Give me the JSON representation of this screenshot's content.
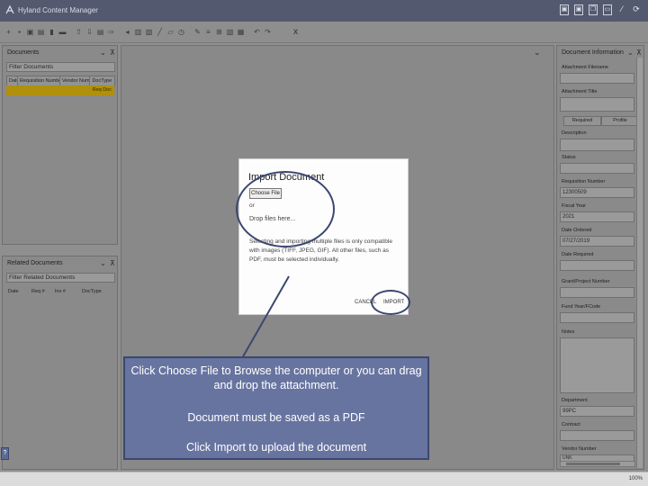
{
  "app": {
    "title": "Hyland Content Manager",
    "window_buttons": [
      "▣",
      "▣",
      "❐",
      "▭",
      "⁄",
      "⟳"
    ]
  },
  "toolbar": {
    "icons": [
      "plus-icon",
      "save-icon",
      "lock-icon",
      "copy-icon",
      "delete-icon",
      "print-icon",
      "separator",
      "upload-icon",
      "download-icon",
      "link-icon",
      "unlink-icon",
      "separator",
      "move-icon",
      "grid-icon",
      "stamp-icon",
      "pen-icon",
      "eraser-icon",
      "clock-icon",
      "separator",
      "markup-icon",
      "align-icon",
      "text-icon",
      "image-icon",
      "table-icon",
      "separator",
      "rotate-left-icon",
      "rotate-right-icon"
    ],
    "glyphs": [
      "+",
      "▪",
      "▣",
      "▤",
      "▮",
      "▬",
      "",
      "⇧",
      "⇩",
      "▤",
      "⇨",
      "",
      "◂",
      "▥",
      "▧",
      "╱",
      "▱",
      "◷",
      "",
      "✎",
      "≡",
      "⊞",
      "▧",
      "▦",
      "",
      "↶",
      "↷"
    ],
    "close": "x"
  },
  "documents_panel": {
    "title": "Documents",
    "filter_placeholder": "Filter Documents",
    "columns": [
      "Date",
      "Requisition Number",
      "Vendor Number",
      "DocType"
    ],
    "selected_row_text": "Req Doc"
  },
  "related_panel": {
    "title": "Related Documents",
    "filter_placeholder": "Filter Related Documents",
    "columns": [
      "Date",
      "Req #",
      "Inv #",
      "DocType"
    ]
  },
  "modal": {
    "title": "Import Document",
    "choose_file": "Choose File",
    "or": "or",
    "drop": "Drop files here...",
    "compat": "Selecting and importing multiple files is only compatible with images (TIFF, JPEG, GIF). All other files, such as PDF, must be selected individually.",
    "cancel": "CANCEL",
    "import": "IMPORT"
  },
  "callout": {
    "line1": "Click Choose File to Browse the computer or you can drag and drop the attachment.",
    "line2": "Document must be saved as a PDF",
    "line3": "Click Import to upload the document"
  },
  "info_panel": {
    "title": "Document Information",
    "attachment_filename": "Attachment Filename",
    "attachment_title": "Attachment Title",
    "tabs": [
      "Required",
      "Profile"
    ],
    "description": "Description",
    "status": "Status",
    "requisition_number_label": "Requisition Number",
    "requisition_number_value": "12300509",
    "fiscal_year_label": "Fiscal Year",
    "fiscal_year_value": "2021",
    "date_ordered_label": "Date Ordered",
    "date_ordered_value": "07/27/2019",
    "date_required_label": "Date Required",
    "grant_project_label": "Grant/Project Number",
    "fund_year_label": "Fund Year/FCode",
    "notes_label": "Notes",
    "department_label": "Department",
    "department_value": "99PC",
    "contract_label": "Contract",
    "vendor_number_label": "Vendor Number",
    "vendor_number_value": "UNK"
  },
  "status": {
    "zoom": "100%"
  }
}
